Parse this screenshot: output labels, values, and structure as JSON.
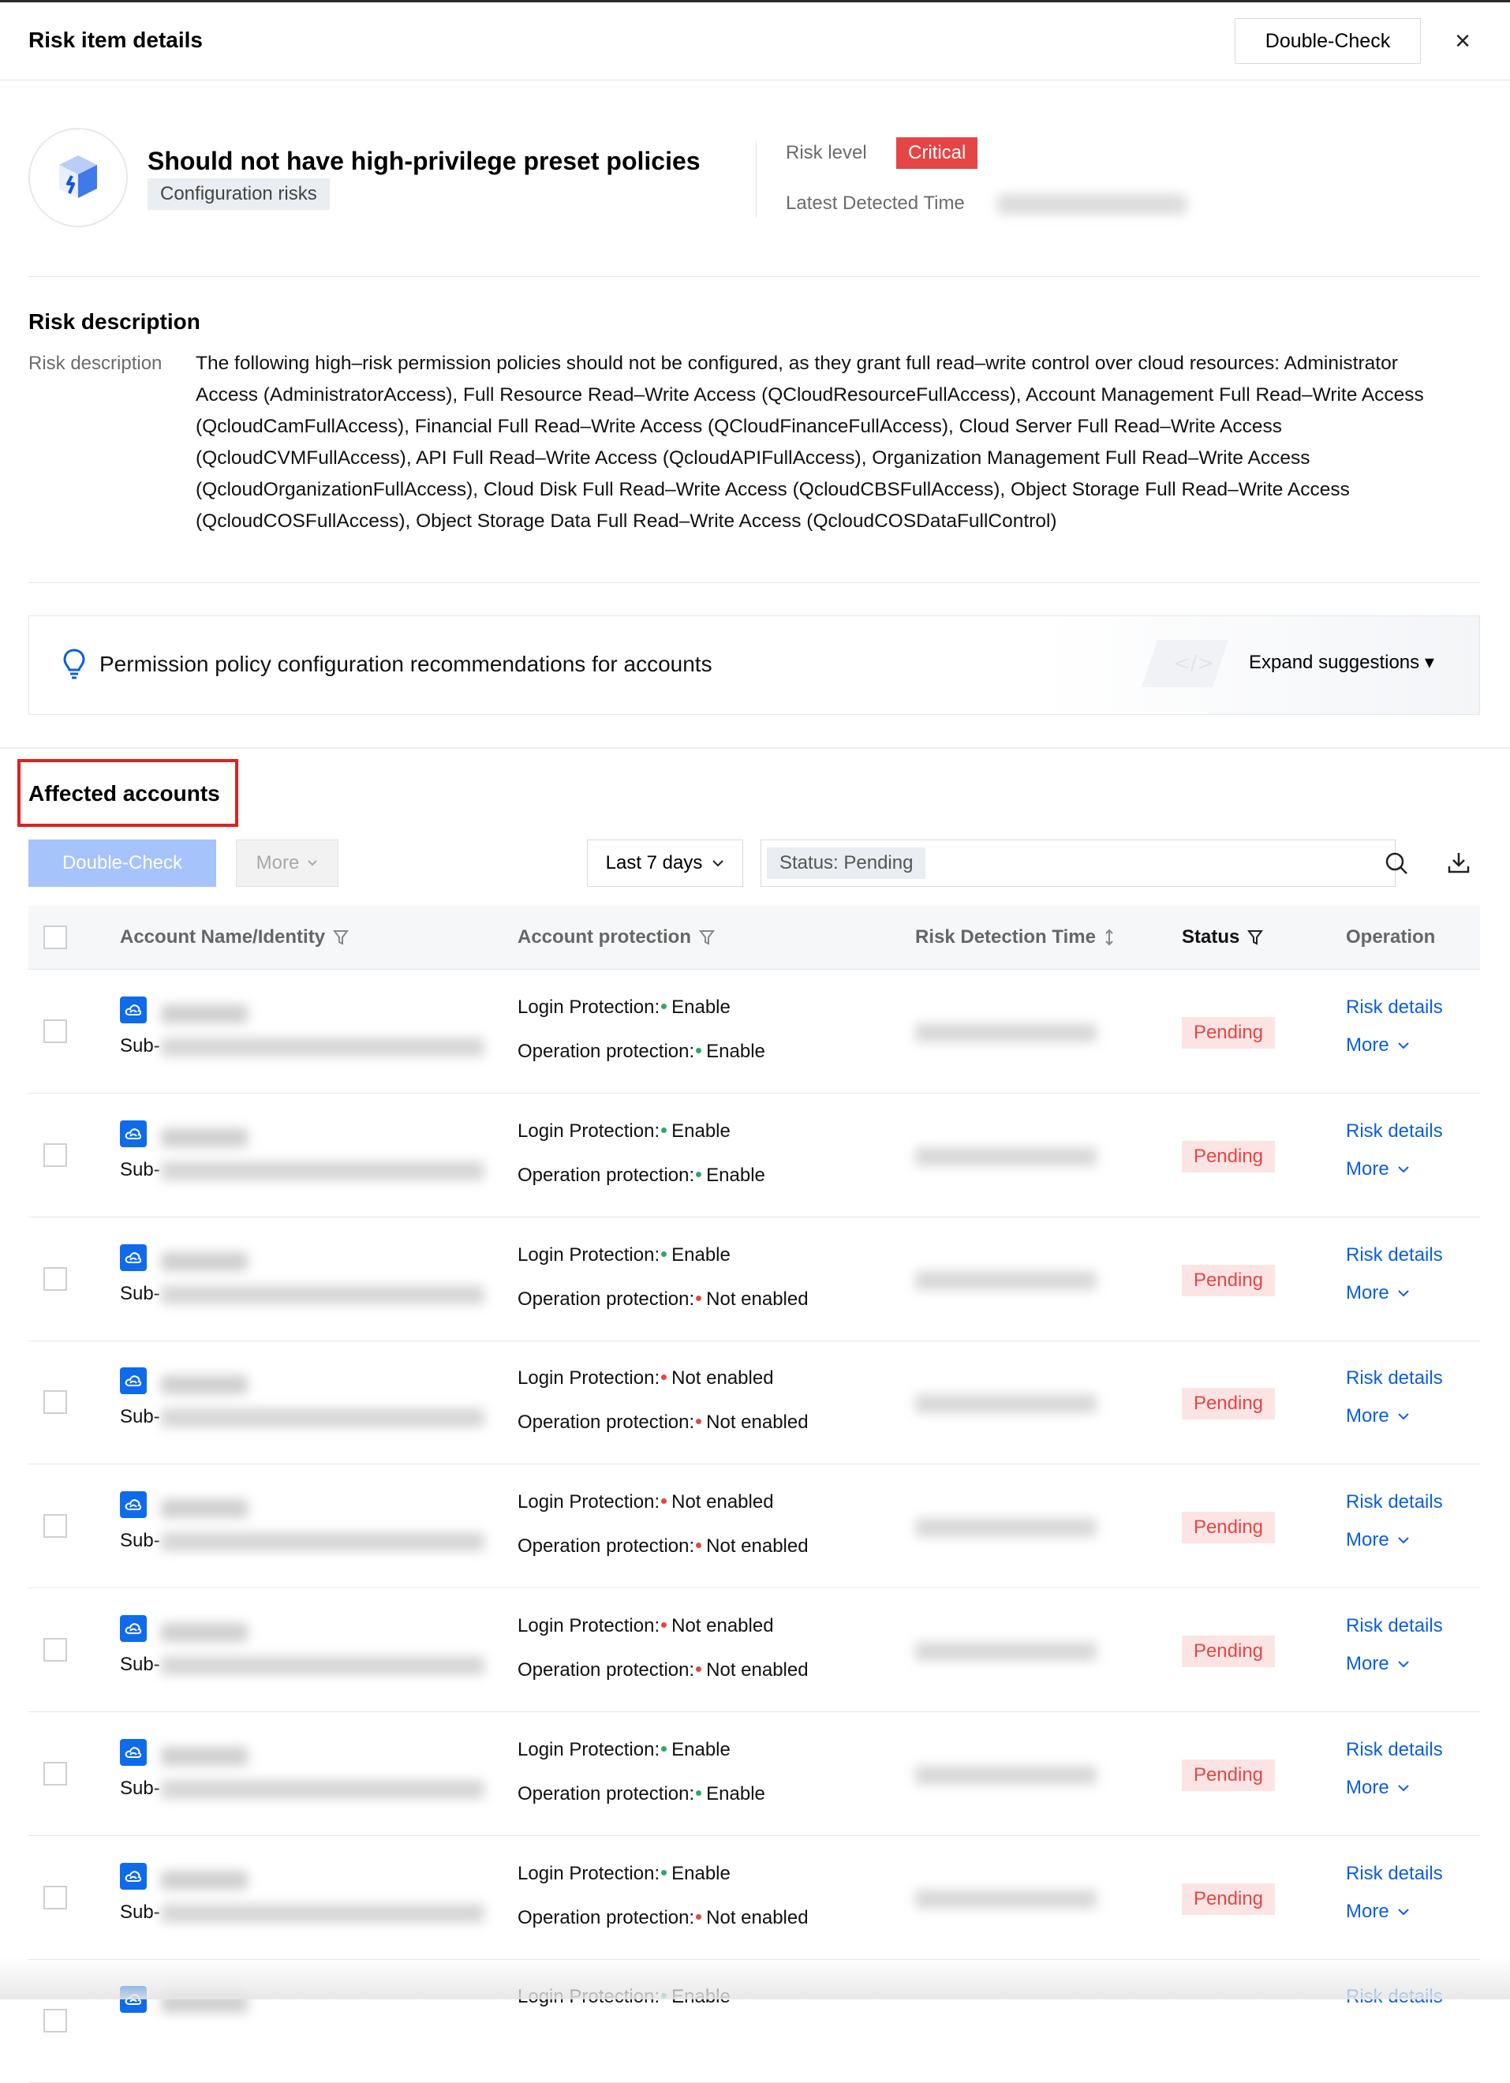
{
  "header": {
    "title": "Risk item details",
    "double_check": "Double-Check",
    "close": "×"
  },
  "risk": {
    "name": "Should not have high-privilege preset policies",
    "category": "Configuration risks",
    "level_label": "Risk level",
    "level": "Critical",
    "time_label": "Latest Detected Time"
  },
  "description": {
    "section_title": "Risk description",
    "label": "Risk description",
    "text": "The following high–risk permission policies should not be configured, as they grant full read–write control over cloud resources: Administrator Access (AdministratorAccess), Full Resource Read–Write Access (QCloudResourceFullAccess), Account Management Full Read–Write Access (QcloudCamFullAccess), Financial Full Read–Write Access (QCloudFinanceFullAccess), Cloud Server Full Read–Write Access (QcloudCVMFullAccess), API Full Read–Write Access (QcloudAPIFullAccess), Organization Management Full Read–Write Access (QcloudOrganizationFullAccess), Cloud Disk Full Read–Write Access (QcloudCBSFullAccess), Object Storage Full Read–Write Access (QcloudCOSFullAccess),  Object Storage Data Full Read–Write Access (QcloudCOSDataFullControl)"
  },
  "suggestion": {
    "text": "Permission policy configuration recommendations for accounts",
    "expand": "Expand suggestions ▾"
  },
  "affected": {
    "title": "Affected accounts",
    "double_check": "Double-Check",
    "more": "More",
    "time_range": "Last 7 days",
    "filter_tag": "Status: Pending"
  },
  "table": {
    "col_account": "Account Name/Identity",
    "col_protection": "Account protection",
    "col_time": "Risk Detection Time",
    "col_status": "Status",
    "col_operation": "Operation",
    "rows": [
      {
        "sub": "Sub-",
        "login_label": "Login Protection:",
        "login": "Enable",
        "op_label": "Operation protection:",
        "op": "Enable",
        "status": "Pending",
        "details": "Risk details",
        "more": "More"
      },
      {
        "sub": "Sub-",
        "login_label": "Login Protection:",
        "login": "Enable",
        "op_label": "Operation protection:",
        "op": "Enable",
        "status": "Pending",
        "details": "Risk details",
        "more": "More"
      },
      {
        "sub": "Sub-",
        "login_label": "Login Protection:",
        "login": "Enable",
        "op_label": "Operation protection:",
        "op": "Not enabled",
        "status": "Pending",
        "details": "Risk details",
        "more": "More"
      },
      {
        "sub": "Sub-",
        "login_label": "Login Protection:",
        "login": "Not enabled",
        "op_label": "Operation protection:",
        "op": "Not enabled",
        "status": "Pending",
        "details": "Risk details",
        "more": "More"
      },
      {
        "sub": "Sub-",
        "login_label": "Login Protection:",
        "login": "Not enabled",
        "op_label": "Operation protection:",
        "op": "Not enabled",
        "status": "Pending",
        "details": "Risk details",
        "more": "More"
      },
      {
        "sub": "Sub-",
        "login_label": "Login Protection:",
        "login": "Not enabled",
        "op_label": "Operation protection:",
        "op": "Not enabled",
        "status": "Pending",
        "details": "Risk details",
        "more": "More"
      },
      {
        "sub": "Sub-",
        "login_label": "Login Protection:",
        "login": "Enable",
        "op_label": "Operation protection:",
        "op": "Enable",
        "status": "Pending",
        "details": "Risk details",
        "more": "More"
      },
      {
        "sub": "Sub-",
        "login_label": "Login Protection:",
        "login": "Enable",
        "op_label": "Operation protection:",
        "op": "Not enabled",
        "status": "Pending",
        "details": "Risk details",
        "more": "More"
      },
      {
        "sub": "",
        "login_label": "Login Protection:",
        "login": "Enable",
        "op_label": "",
        "op": "",
        "status": "",
        "details": "Risk details",
        "more": ""
      }
    ]
  },
  "colors": {
    "accent": "#0b5fdc",
    "critical": "#e54545",
    "pending_bg": "#fde4e4",
    "enabled_dot": "#2ea66a",
    "disabled_dot": "#e54545"
  }
}
